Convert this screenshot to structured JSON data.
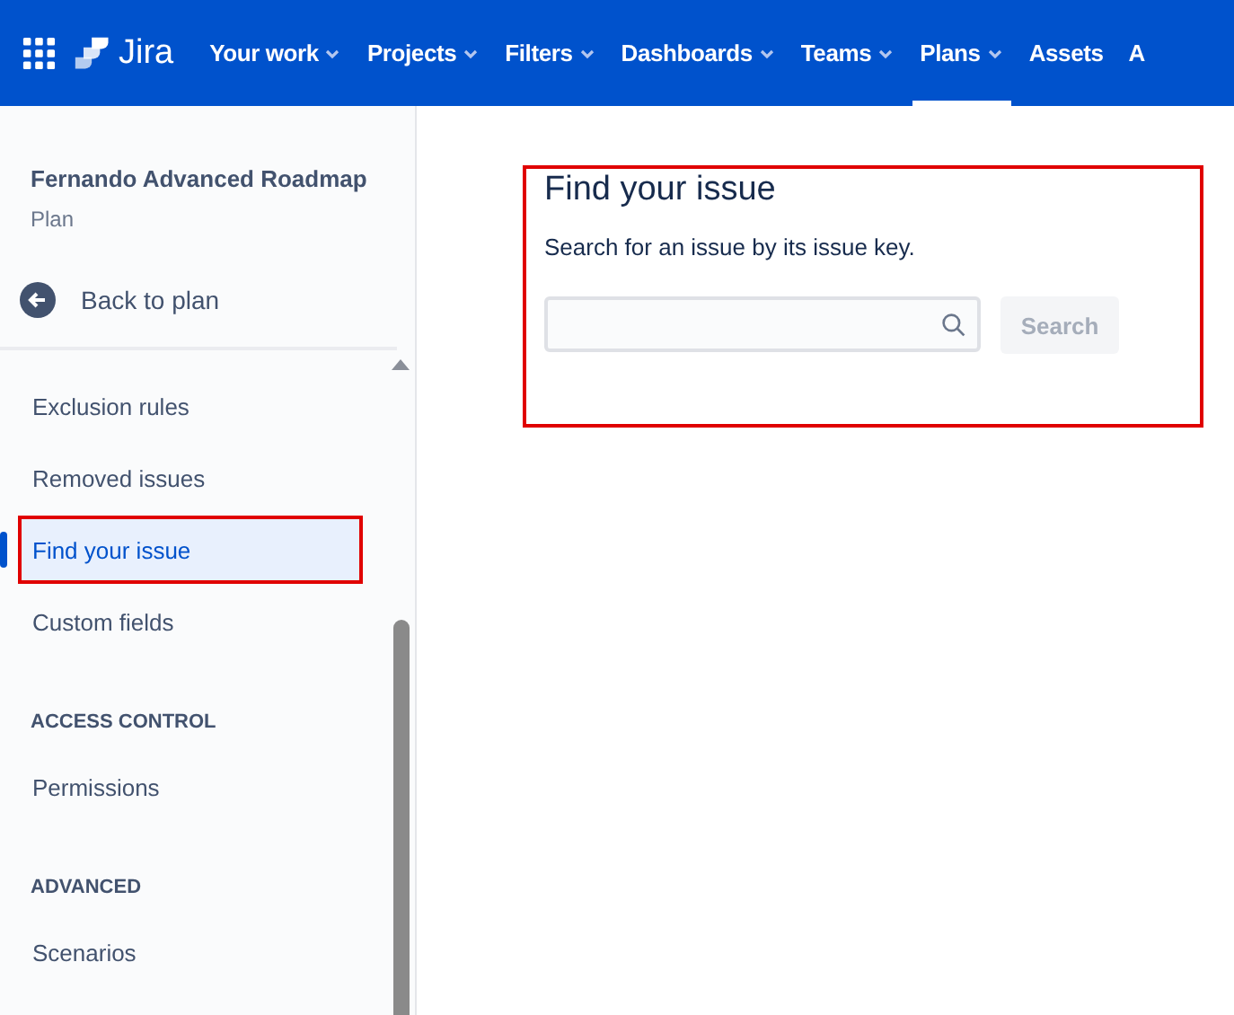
{
  "nav": {
    "product": "Jira",
    "items": [
      {
        "label": "Your work",
        "caret": true,
        "selected": false
      },
      {
        "label": "Projects",
        "caret": true,
        "selected": false
      },
      {
        "label": "Filters",
        "caret": true,
        "selected": false
      },
      {
        "label": "Dashboards",
        "caret": true,
        "selected": false
      },
      {
        "label": "Teams",
        "caret": true,
        "selected": false
      },
      {
        "label": "Plans",
        "caret": true,
        "selected": true
      },
      {
        "label": "Assets",
        "caret": false,
        "selected": false
      },
      {
        "label": "A",
        "caret": false,
        "selected": false
      }
    ]
  },
  "sidebar": {
    "title": "Fernando Advanced Roadmap",
    "subtitle": "Plan",
    "back": "Back to plan",
    "items": [
      {
        "kind": "item",
        "label": "Exclusion rules",
        "selected": false,
        "highlighted": false
      },
      {
        "kind": "item",
        "label": "Removed issues",
        "selected": false,
        "highlighted": false
      },
      {
        "kind": "item",
        "label": "Find your issue",
        "selected": true,
        "highlighted": true
      },
      {
        "kind": "item",
        "label": "Custom fields",
        "selected": false,
        "highlighted": false
      },
      {
        "kind": "heading",
        "label": "ACCESS CONTROL"
      },
      {
        "kind": "item",
        "label": "Permissions",
        "selected": false,
        "highlighted": false
      },
      {
        "kind": "heading",
        "label": "ADVANCED"
      },
      {
        "kind": "item",
        "label": "Scenarios",
        "selected": false,
        "highlighted": false
      }
    ]
  },
  "panel": {
    "highlighted": true,
    "title": "Find your issue",
    "description": "Search for an issue by its issue key.",
    "search_button": {
      "label": "Search",
      "disabled": true
    }
  }
}
